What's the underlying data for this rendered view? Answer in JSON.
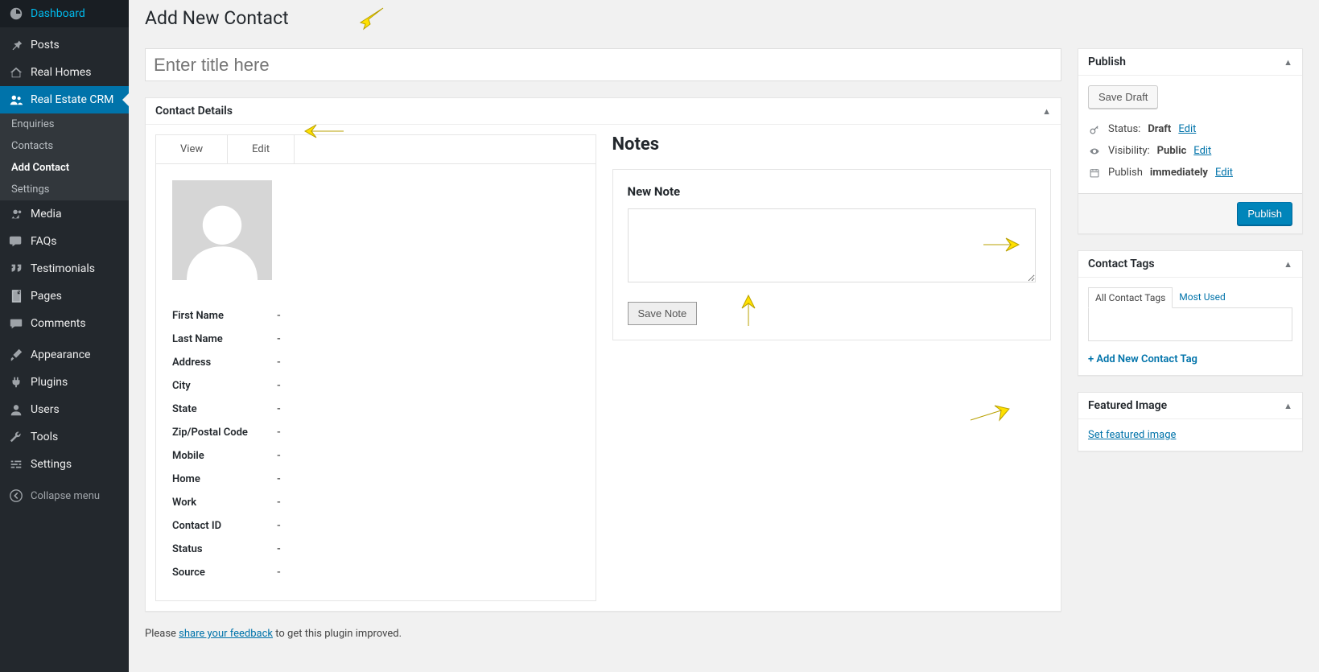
{
  "sidebar": {
    "items": [
      {
        "id": "dashboard",
        "label": "Dashboard",
        "icon": "dashboard-icon"
      },
      {
        "id": "posts",
        "label": "Posts",
        "icon": "pin-icon"
      },
      {
        "id": "realhomes",
        "label": "Real Homes",
        "icon": "home-icon"
      },
      {
        "id": "recrm",
        "label": "Real Estate CRM",
        "icon": "users-icon",
        "active": true,
        "submenu": [
          {
            "id": "enquiries",
            "label": "Enquiries"
          },
          {
            "id": "contacts",
            "label": "Contacts"
          },
          {
            "id": "addcontact",
            "label": "Add Contact",
            "current": true
          },
          {
            "id": "settings",
            "label": "Settings"
          }
        ]
      },
      {
        "id": "media",
        "label": "Media",
        "icon": "media-icon"
      },
      {
        "id": "faqs",
        "label": "FAQs",
        "icon": "chat-icon"
      },
      {
        "id": "testimonials",
        "label": "Testimonials",
        "icon": "quote-icon"
      },
      {
        "id": "pages",
        "label": "Pages",
        "icon": "page-icon"
      },
      {
        "id": "comments",
        "label": "Comments",
        "icon": "comment-icon"
      },
      {
        "id": "appearance",
        "label": "Appearance",
        "icon": "brush-icon"
      },
      {
        "id": "plugins",
        "label": "Plugins",
        "icon": "plug-icon"
      },
      {
        "id": "users",
        "label": "Users",
        "icon": "user-icon"
      },
      {
        "id": "tools",
        "label": "Tools",
        "icon": "wrench-icon"
      },
      {
        "id": "wpsettings",
        "label": "Settings",
        "icon": "sliders-icon"
      }
    ],
    "collapse_label": "Collapse menu"
  },
  "page": {
    "title": "Add New Contact",
    "title_placeholder": "Enter title here"
  },
  "contact_details": {
    "heading": "Contact Details",
    "tabs": {
      "view": "View",
      "edit": "Edit"
    },
    "fields": [
      {
        "label": "First Name",
        "value": "-"
      },
      {
        "label": "Last Name",
        "value": "-"
      },
      {
        "label": "Address",
        "value": "-"
      },
      {
        "label": "City",
        "value": "-"
      },
      {
        "label": "State",
        "value": "-"
      },
      {
        "label": "Zip/Postal Code",
        "value": "-"
      },
      {
        "label": "Mobile",
        "value": "-"
      },
      {
        "label": "Home",
        "value": "-"
      },
      {
        "label": "Work",
        "value": "-"
      },
      {
        "label": "Contact ID",
        "value": "-"
      },
      {
        "label": "Status",
        "value": "-"
      },
      {
        "label": "Source",
        "value": "-"
      }
    ]
  },
  "notes": {
    "heading": "Notes",
    "new_note_label": "New Note",
    "save_note": "Save Note"
  },
  "publish": {
    "heading": "Publish",
    "save_draft": "Save Draft",
    "status_label": "Status:",
    "status_value": "Draft",
    "visibility_label": "Visibility:",
    "visibility_value": "Public",
    "schedule_label": "Publish",
    "schedule_value": "immediately",
    "edit_label": "Edit",
    "publish_button": "Publish"
  },
  "contact_tags": {
    "heading": "Contact Tags",
    "tab_all": "All Contact Tags",
    "tab_most": "Most Used",
    "add_new": "+ Add New Contact Tag"
  },
  "featured": {
    "heading": "Featured Image",
    "set_link": "Set featured image"
  },
  "feedback": {
    "prefix": "Please ",
    "link": "share your feedback",
    "suffix": " to get this plugin improved."
  }
}
